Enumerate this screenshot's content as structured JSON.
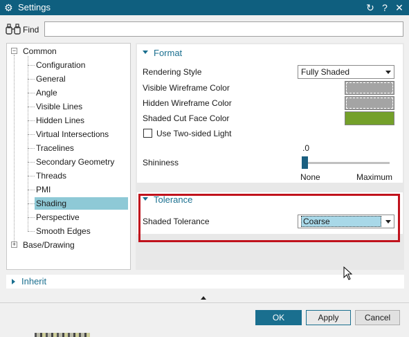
{
  "window": {
    "title": "Settings",
    "buttons": [
      "refresh-icon",
      "help-icon",
      "close-icon"
    ]
  },
  "find": {
    "label": "Find",
    "value": "",
    "placeholder": ""
  },
  "tree": {
    "items": [
      {
        "label": "Common",
        "level": 0,
        "expanded": true
      },
      {
        "label": "Configuration",
        "level": 1
      },
      {
        "label": "General",
        "level": 1
      },
      {
        "label": "Angle",
        "level": 1
      },
      {
        "label": "Visible Lines",
        "level": 1
      },
      {
        "label": "Hidden Lines",
        "level": 1
      },
      {
        "label": "Virtual Intersections",
        "level": 1
      },
      {
        "label": "Tracelines",
        "level": 1
      },
      {
        "label": "Secondary Geometry",
        "level": 1
      },
      {
        "label": "Threads",
        "level": 1
      },
      {
        "label": "PMI",
        "level": 1
      },
      {
        "label": "Shading",
        "level": 1,
        "selected": true
      },
      {
        "label": "Perspective",
        "level": 1
      },
      {
        "label": "Smooth Edges",
        "level": 1
      },
      {
        "label": "Base/Drawing",
        "level": 0,
        "expanded": false
      }
    ]
  },
  "format": {
    "header": "Format",
    "rendering_style_label": "Rendering Style",
    "rendering_style_value": "Fully Shaded",
    "visible_wireframe_label": "Visible Wireframe Color",
    "hidden_wireframe_label": "Hidden Wireframe Color",
    "shaded_cut_face_label": "Shaded Cut Face Color",
    "two_sided_light_label": "Use Two-sided Light",
    "two_sided_light_checked": false,
    "shininess_label": "Shininess",
    "shininess_value": ".0",
    "shininess_fraction": 0.0,
    "shininess_min_label": "None",
    "shininess_max_label": "Maximum",
    "visible_wireframe_color": "#a4a4a4",
    "hidden_wireframe_color": "#a4a4a4",
    "shaded_cut_face_color": "#74a02a"
  },
  "tolerance": {
    "header": "Tolerance",
    "shaded_tolerance_label": "Shaded Tolerance",
    "shaded_tolerance_value": "Coarse"
  },
  "inherit": {
    "header": "Inherit"
  },
  "buttons": {
    "ok": "OK",
    "apply": "Apply",
    "cancel": "Cancel"
  },
  "colors": {
    "titlebar": "#0f5f7f",
    "accent": "#1a6f8f",
    "selection": "#8ec9d6",
    "highlight_border": "#c0121c"
  }
}
